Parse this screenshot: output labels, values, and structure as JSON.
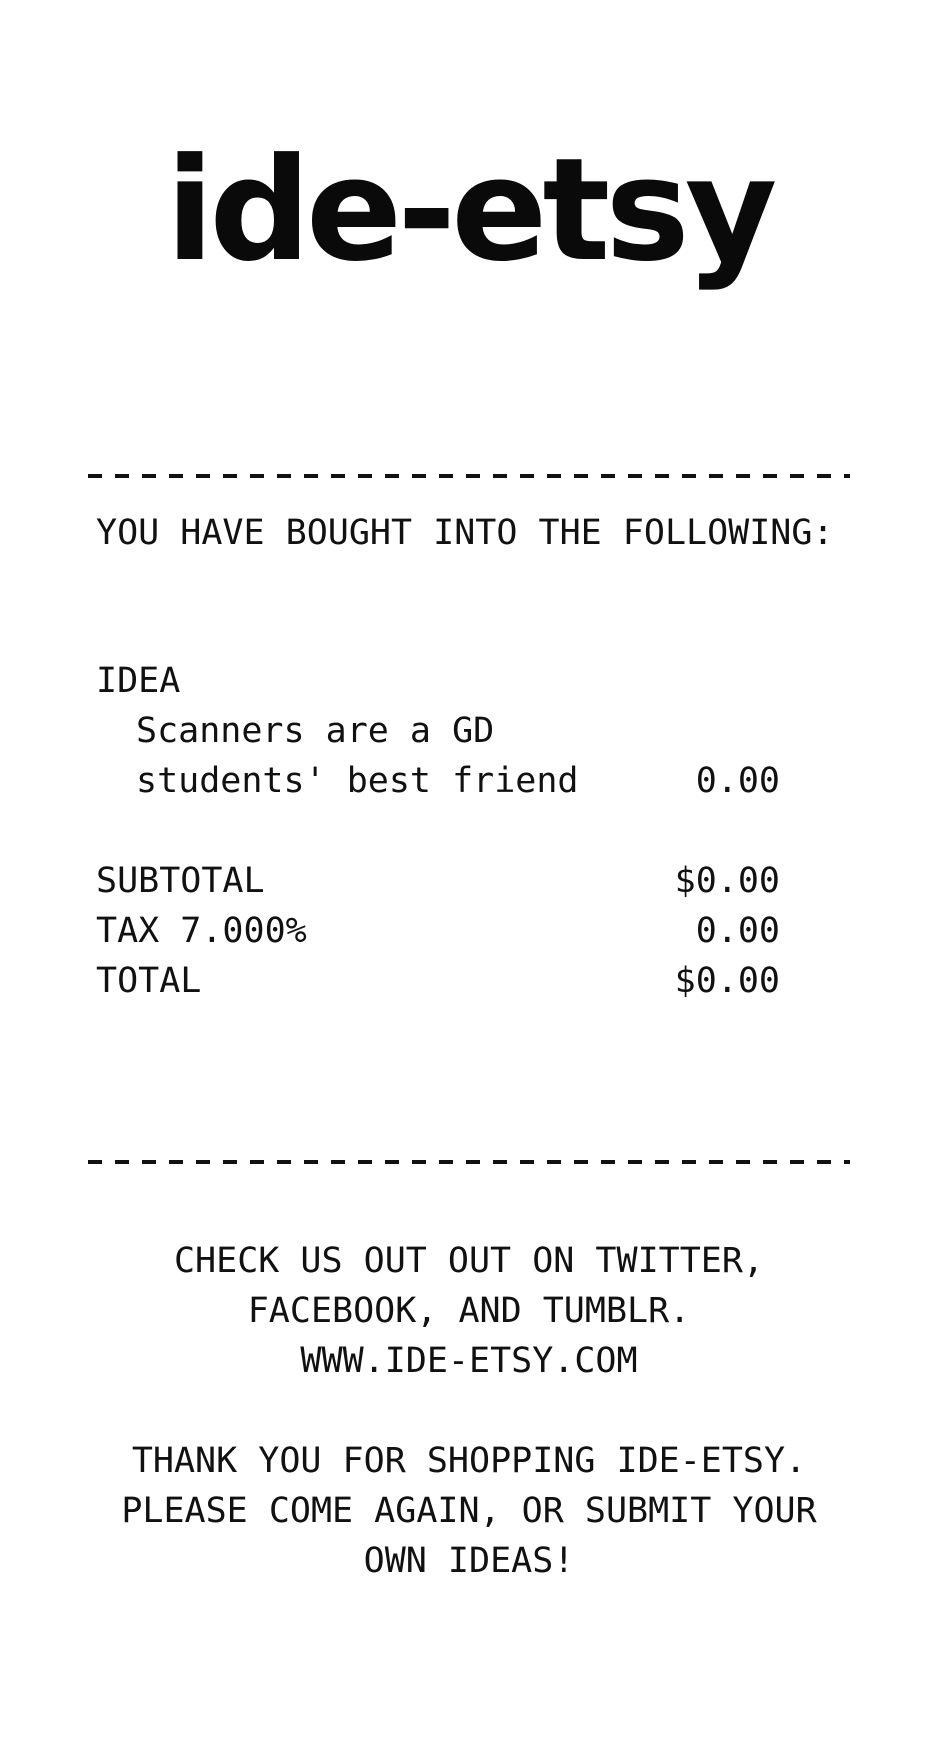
{
  "logo_text": "ide-etsy",
  "heading": "YOU HAVE BOUGHT INTO THE FOLLOWING:",
  "item": {
    "category": "IDEA",
    "description_line1": "Scanners are a GD",
    "description_line2": "students' best friend",
    "amount": "0.00"
  },
  "totals": {
    "subtotal_label": "SUBTOTAL",
    "subtotal_value": "$0.00",
    "tax_label": "TAX 7.000%",
    "tax_value": "0.00",
    "total_label": "TOTAL",
    "total_value": "$0.00"
  },
  "footer": {
    "social_line1": "CHECK US OUT OUT ON TWITTER,",
    "social_line2": "FACEBOOK, AND TUMBLR.",
    "website": "WWW.IDE-ETSY.COM",
    "thanks_line1": "THANK YOU FOR SHOPPING IDE-ETSY.",
    "thanks_line2": "PLEASE COME AGAIN, OR SUBMIT YOUR",
    "thanks_line3": "OWN IDEAS!"
  }
}
